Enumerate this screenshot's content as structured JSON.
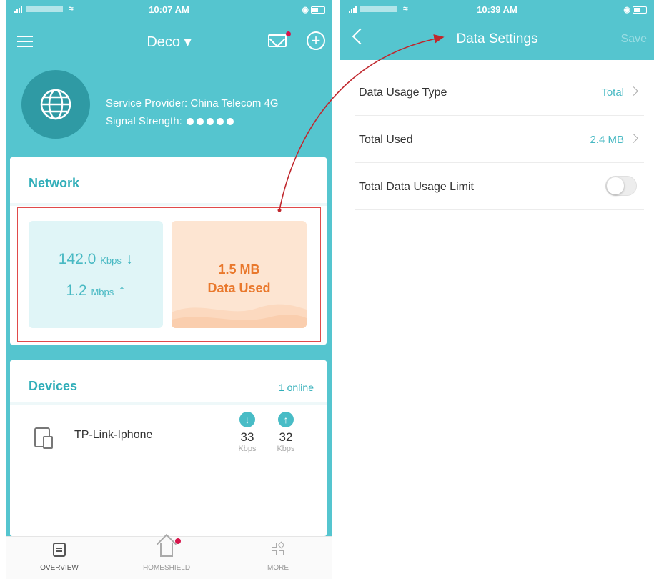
{
  "left": {
    "status": {
      "time": "10:07 AM"
    },
    "nav": {
      "title": "Deco ▾"
    },
    "internet": {
      "provider": "Service Provider: China Telecom 4G",
      "strength_label": "Signal Strength:"
    },
    "network": {
      "title": "Network",
      "download_value": "142.0",
      "download_unit": "Kbps",
      "upload_value": "1.2",
      "upload_unit": "Mbps",
      "data_amount": "1.5 MB",
      "data_label": "Data Used"
    },
    "devices": {
      "title": "Devices",
      "online": "1 online",
      "items": [
        {
          "name": "TP-Link-Iphone",
          "down": "33",
          "down_unit": "Kbps",
          "up": "32",
          "up_unit": "Kbps"
        }
      ]
    },
    "tabs": [
      {
        "label": "OVERVIEW"
      },
      {
        "label": "HOMESHIELD"
      },
      {
        "label": "MORE"
      }
    ]
  },
  "right": {
    "status": {
      "time": "10:39 AM"
    },
    "nav": {
      "title": "Data Settings",
      "save": "Save"
    },
    "settings": [
      {
        "label": "Data Usage Type",
        "value": "Total"
      },
      {
        "label": "Total Used",
        "value": "2.4 MB"
      },
      {
        "label": "Total Data Usage Limit",
        "value": ""
      }
    ]
  },
  "colors": {
    "teal": "#55c5cf",
    "accent_teal": "#31aeb9",
    "data_orange": "#e9782c",
    "data_bg": "#fde5d2",
    "highlight_red": "#e04a4a"
  }
}
